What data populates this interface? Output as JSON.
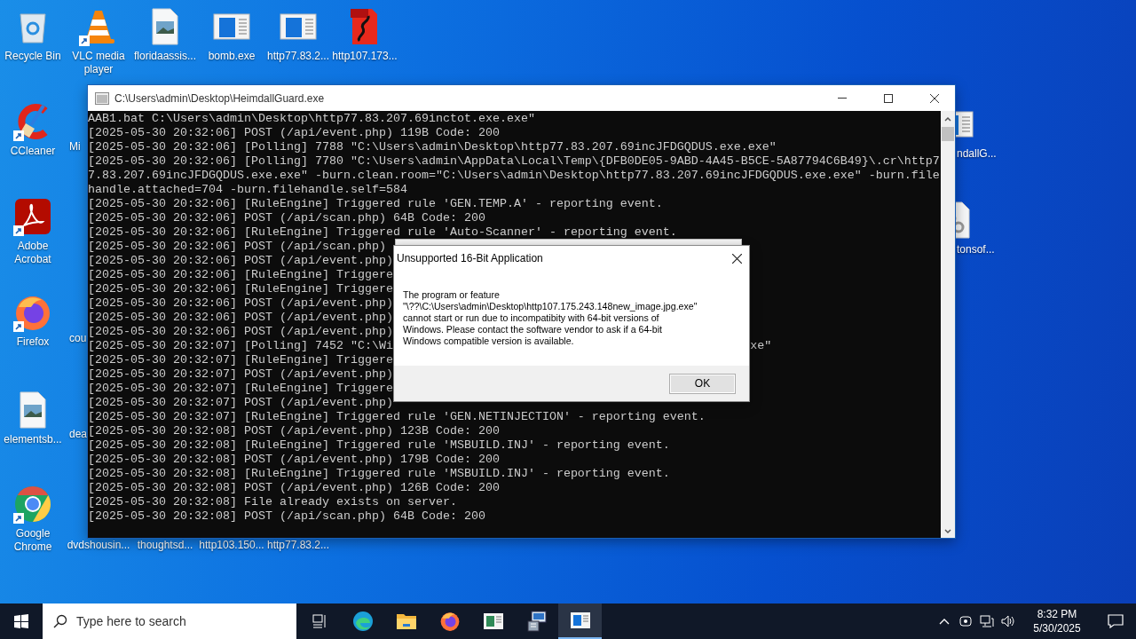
{
  "desktop_icons": [
    {
      "label": "Recycle Bin",
      "kind": "recycle-bin",
      "shortcut": false
    },
    {
      "label": "VLC media player",
      "kind": "cone",
      "shortcut": true
    },
    {
      "label": "floridaassis...",
      "kind": "image-file",
      "shortcut": false
    },
    {
      "label": "bomb.exe",
      "kind": "app-window",
      "shortcut": false
    },
    {
      "label": "http77.83.2...",
      "kind": "app-window",
      "shortcut": false
    },
    {
      "label": "http107.173...",
      "kind": "pdf",
      "shortcut": false
    },
    {
      "label": "CCleaner",
      "kind": "cleaner",
      "shortcut": true
    },
    {
      "label": "Adobe Acrobat",
      "kind": "acrobat",
      "shortcut": true
    },
    {
      "label": "Firefox",
      "kind": "firefox",
      "shortcut": true
    },
    {
      "label": "elementsb...",
      "kind": "image-file",
      "shortcut": false
    },
    {
      "label": "Google Chrome",
      "kind": "chrome",
      "shortcut": true
    },
    {
      "label": "Mi",
      "kind": "none"
    },
    {
      "label": "cou",
      "kind": "none"
    },
    {
      "label": "dea",
      "kind": "none"
    },
    {
      "label": "dvdshousin...",
      "kind": "none"
    },
    {
      "label": "thoughtsd...",
      "kind": "none"
    },
    {
      "label": "http103.150...",
      "kind": "none"
    },
    {
      "label": "http77.83.2...",
      "kind": "none"
    },
    {
      "label": "ndallG...",
      "kind": "app-window",
      "shortcut": false
    },
    {
      "label": "tonsof...",
      "kind": "gear-file",
      "shortcut": false
    }
  ],
  "console": {
    "title": "C:\\Users\\admin\\Desktop\\HeimdallGuard.exe",
    "lines": [
      {
        "text": "AAB1.bat C:\\Users\\admin\\Desktop\\http77.83.207.69inctot.exe.exe\""
      },
      {
        "text": "[2025-05-30 20:32:06] POST (/api/event.php) 119B Code: 200"
      },
      {
        "text": "[2025-05-30 20:32:06] [Polling] 7788 \"C:\\Users\\admin\\Desktop\\http77.83.207.69incJFDGQDUS.exe.exe\""
      },
      {
        "text": "[2025-05-30 20:32:06] [Polling] 7780 \"C:\\Users\\admin\\AppData\\Local\\Temp\\{DFB0DE05-9ABD-4A45-B5CE-5A87794C6B49}\\.cr\\http7"
      },
      {
        "text": "7.83.207.69incJFDGQDUS.exe.exe\" -burn.clean.room=\"C:\\Users\\admin\\Desktop\\http77.83.207.69incJFDGQDUS.exe.exe\" -burn.file"
      },
      {
        "text": "handle.attached=704 -burn.filehandle.self=584"
      },
      {
        "text": "[2025-05-30 20:32:06] [RuleEngine] Triggered rule 'GEN.TEMP.A' - reporting event."
      },
      {
        "text": "[2025-05-30 20:32:06] POST (/api/scan.php) 64B Code: 200"
      },
      {
        "text": "[2025-05-30 20:32:06] [RuleEngine] Triggered rule 'Auto-Scanner' - reporting event."
      },
      {
        "text": "[2025-05-30 20:32:06] POST (/api/scan.php)"
      },
      {
        "text": "[2025-05-30 20:32:06] POST (/api/event.php)"
      },
      {
        "text": "[2025-05-30 20:32:06] [RuleEngine] Triggere"
      },
      {
        "text": "[2025-05-30 20:32:06] [RuleEngine] Triggere"
      },
      {
        "text": "[2025-05-30 20:32:06] POST (/api/event.php)"
      },
      {
        "text": "[2025-05-30 20:32:06] POST (/api/event.php)"
      },
      {
        "text": "[2025-05-30 20:32:06] POST (/api/event.php)"
      },
      {
        "text": "[2025-05-30 20:32:07] [Polling] 7452 \"C:\\Wi",
        "tail": "xe\""
      },
      {
        "text": "[2025-05-30 20:32:07] [RuleEngine] Triggere"
      },
      {
        "text": "[2025-05-30 20:32:07] POST (/api/event.php)"
      },
      {
        "text": "[2025-05-30 20:32:07] [RuleEngine] Triggere"
      },
      {
        "text": "[2025-05-30 20:32:07] POST (/api/event.php)"
      },
      {
        "text": "[2025-05-30 20:32:07] [RuleEngine] Triggered rule 'GEN.NETINJECTION' - reporting event."
      },
      {
        "text": "[2025-05-30 20:32:08] POST (/api/event.php) 123B Code: 200"
      },
      {
        "text": "[2025-05-30 20:32:08] [RuleEngine] Triggered rule 'MSBUILD.INJ' - reporting event."
      },
      {
        "text": "[2025-05-30 20:32:08] POST (/api/event.php) 179B Code: 200"
      },
      {
        "text": "[2025-05-30 20:32:08] [RuleEngine] Triggered rule 'MSBUILD.INJ' - reporting event."
      },
      {
        "text": "[2025-05-30 20:32:08] POST (/api/event.php) 126B Code: 200"
      },
      {
        "text": "[2025-05-30 20:32:08] File already exists on server."
      },
      {
        "text": "[2025-05-30 20:32:08] POST (/api/scan.php) 64B Code: 200"
      }
    ]
  },
  "dialog": {
    "title": "Unsupported 16-Bit Application",
    "message": "The program or feature\n\"\\??\\C:\\Users\\admin\\Desktop\\http107.175.243.148new_image.jpg.exe\"\ncannot start or run due to incompatibity with 64-bit versions of\nWindows. Please contact the software vendor to ask if a 64-bit\nWindows compatible version is available.",
    "button": "OK"
  },
  "taskbar": {
    "search_placeholder": "Type here to search",
    "apps": [
      {
        "kind": "task-view",
        "active": false
      },
      {
        "kind": "edge",
        "active": false
      },
      {
        "kind": "folder",
        "active": false
      },
      {
        "kind": "firefox",
        "active": false
      },
      {
        "kind": "app-window",
        "active": false
      },
      {
        "kind": "installer",
        "active": false
      },
      {
        "kind": "console",
        "active": true
      }
    ],
    "time": "8:32 PM",
    "date": "5/30/2025"
  }
}
